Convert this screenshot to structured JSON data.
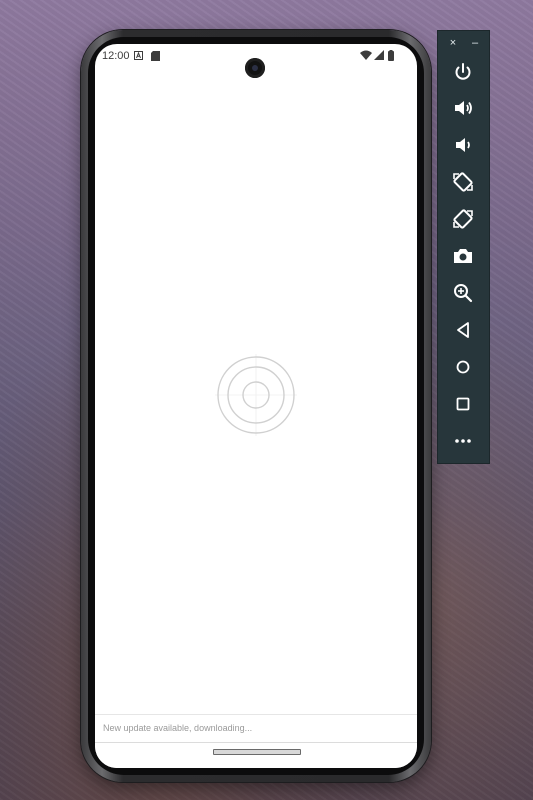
{
  "status_bar": {
    "time": "12:00",
    "icons": [
      "a-notification-icon",
      "sd-card-icon",
      "wifi-icon",
      "signal-icon",
      "battery-icon"
    ]
  },
  "app": {
    "update_message": "New update available, downloading..."
  },
  "emulator_toolbar": {
    "window_controls": {
      "close": "×",
      "minimize": "–"
    },
    "buttons": [
      "power-icon",
      "volume-up-icon",
      "volume-down-icon",
      "rotate-left-icon",
      "rotate-right-icon",
      "camera-icon",
      "zoom-icon",
      "back-icon",
      "home-icon",
      "overview-icon",
      "more-icon"
    ]
  },
  "colors": {
    "toolbar_background": "#27363b",
    "toolbar_icon": "#ffffff",
    "screen_background": "#ffffff"
  }
}
